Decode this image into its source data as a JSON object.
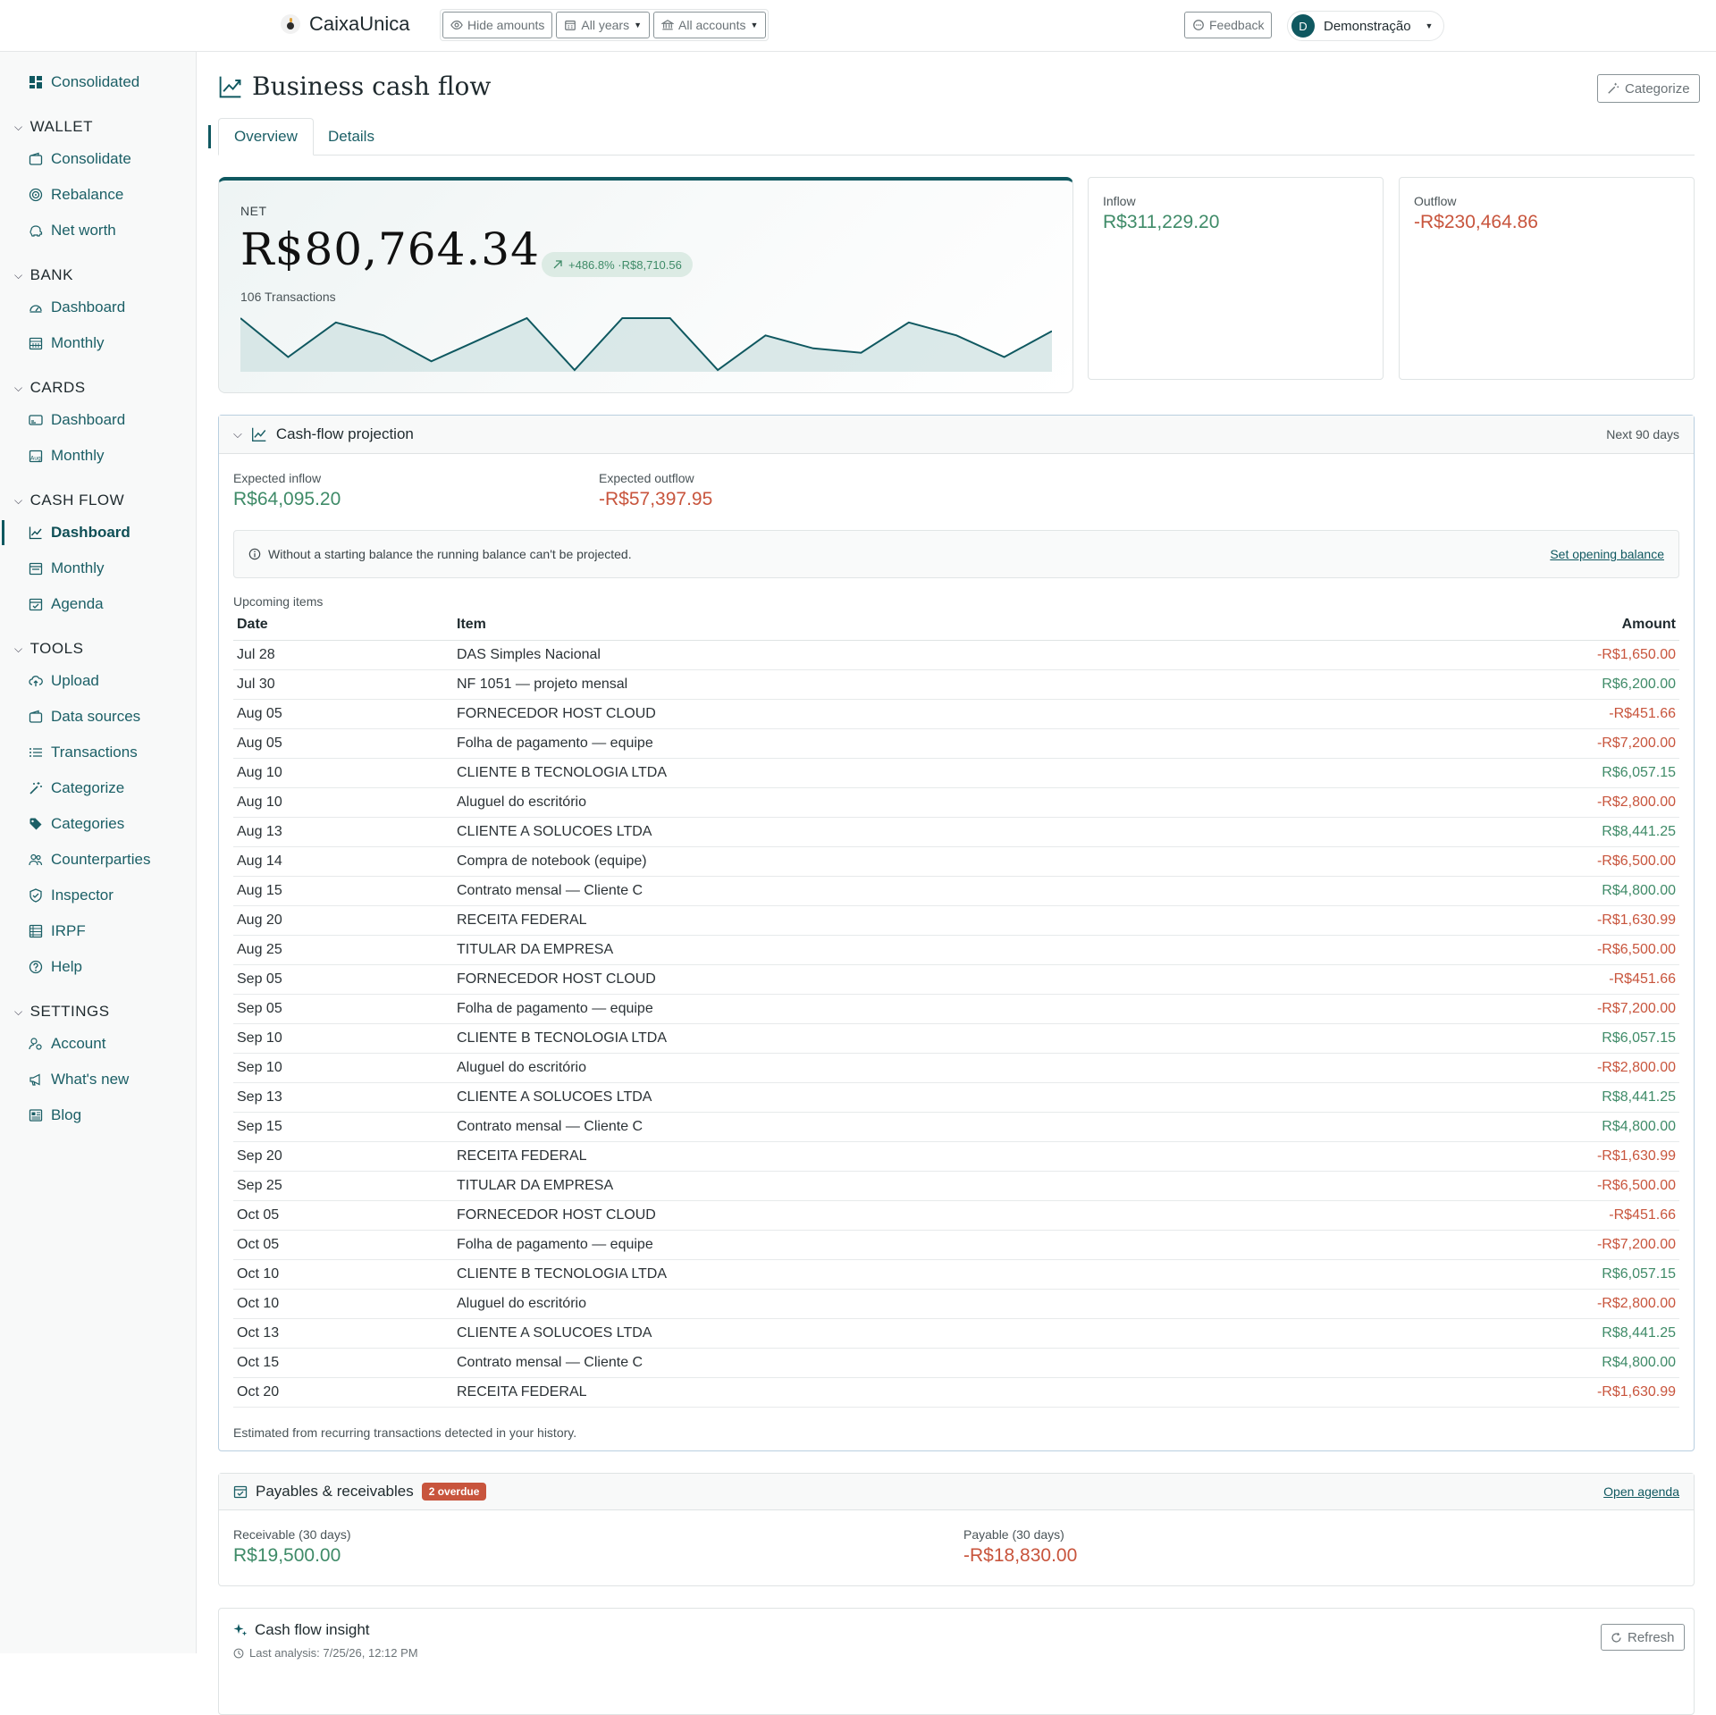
{
  "header": {
    "brand": "CaixaUnica",
    "filters": [
      {
        "label": "Hide amounts",
        "icon": "eye-icon"
      },
      {
        "label": "All years",
        "icon": "calendar-icon"
      },
      {
        "label": "All accounts",
        "icon": "bank-icon"
      }
    ],
    "feedback_label": "Feedback",
    "user": {
      "initial": "D",
      "name": "Demonstração"
    }
  },
  "sidebar": {
    "top_item": "Consolidated",
    "sections": [
      {
        "title": "WALLET",
        "items": [
          "Consolidate",
          "Rebalance",
          "Net worth"
        ]
      },
      {
        "title": "BANK",
        "items": [
          "Dashboard",
          "Monthly"
        ]
      },
      {
        "title": "CARDS",
        "items": [
          "Dashboard",
          "Monthly"
        ]
      },
      {
        "title": "CASH FLOW",
        "items": [
          "Dashboard",
          "Monthly",
          "Agenda"
        ],
        "active": "Dashboard"
      },
      {
        "title": "TOOLS",
        "items": [
          "Upload",
          "Data sources",
          "Transactions",
          "Categorize",
          "Categories",
          "Counterparties",
          "Inspector",
          "IRPF",
          "Help"
        ]
      },
      {
        "title": "SETTINGS",
        "items": [
          "Account",
          "What's new",
          "Blog"
        ]
      }
    ]
  },
  "page": {
    "title": "Business cash flow",
    "categorize_label": "Categorize",
    "tabs": [
      {
        "label": "Overview",
        "active": true
      },
      {
        "label": "Details",
        "active": false
      }
    ]
  },
  "net": {
    "label": "NET",
    "value": "R$80,764.34",
    "badge": "+486.8% ·R$8,710.56",
    "transactions": "106 Transactions",
    "sparkline": [
      12,
      3,
      11,
      8,
      2,
      7,
      12,
      0,
      12,
      12,
      0,
      8,
      5,
      4,
      11,
      8,
      3,
      9
    ]
  },
  "inflow": {
    "label": "Inflow",
    "value": "R$311,229.20"
  },
  "outflow": {
    "label": "Outflow",
    "value": "-R$230,464.86"
  },
  "projection": {
    "title": "Cash-flow projection",
    "range": "Next 90 days",
    "expected_inflow_label": "Expected inflow",
    "expected_inflow": "R$64,095.20",
    "expected_outflow_label": "Expected outflow",
    "expected_outflow": "-R$57,397.95",
    "notice": "Without a starting balance the running balance can't be projected.",
    "notice_link": "Set opening balance",
    "upcoming_label": "Upcoming items",
    "columns": {
      "date": "Date",
      "item": "Item",
      "amount": "Amount"
    },
    "rows": [
      {
        "date": "Jul 28",
        "item": "DAS Simples Nacional",
        "amount": "-R$1,650.00",
        "sign": "neg"
      },
      {
        "date": "Jul 30",
        "item": "NF 1051 — projeto mensal",
        "amount": "R$6,200.00",
        "sign": "pos"
      },
      {
        "date": "Aug 05",
        "item": "FORNECEDOR HOST CLOUD",
        "amount": "-R$451.66",
        "sign": "neg"
      },
      {
        "date": "Aug 05",
        "item": "Folha de pagamento — equipe",
        "amount": "-R$7,200.00",
        "sign": "neg"
      },
      {
        "date": "Aug 10",
        "item": "CLIENTE B TECNOLOGIA LTDA",
        "amount": "R$6,057.15",
        "sign": "pos"
      },
      {
        "date": "Aug 10",
        "item": "Aluguel do escritório",
        "amount": "-R$2,800.00",
        "sign": "neg"
      },
      {
        "date": "Aug 13",
        "item": "CLIENTE A SOLUCOES LTDA",
        "amount": "R$8,441.25",
        "sign": "pos"
      },
      {
        "date": "Aug 14",
        "item": "Compra de notebook (equipe)",
        "amount": "-R$6,500.00",
        "sign": "neg"
      },
      {
        "date": "Aug 15",
        "item": "Contrato mensal — Cliente C",
        "amount": "R$4,800.00",
        "sign": "pos"
      },
      {
        "date": "Aug 20",
        "item": "RECEITA FEDERAL",
        "amount": "-R$1,630.99",
        "sign": "neg"
      },
      {
        "date": "Aug 25",
        "item": "TITULAR DA EMPRESA",
        "amount": "-R$6,500.00",
        "sign": "neg"
      },
      {
        "date": "Sep 05",
        "item": "FORNECEDOR HOST CLOUD",
        "amount": "-R$451.66",
        "sign": "neg"
      },
      {
        "date": "Sep 05",
        "item": "Folha de pagamento — equipe",
        "amount": "-R$7,200.00",
        "sign": "neg"
      },
      {
        "date": "Sep 10",
        "item": "CLIENTE B TECNOLOGIA LTDA",
        "amount": "R$6,057.15",
        "sign": "pos"
      },
      {
        "date": "Sep 10",
        "item": "Aluguel do escritório",
        "amount": "-R$2,800.00",
        "sign": "neg"
      },
      {
        "date": "Sep 13",
        "item": "CLIENTE A SOLUCOES LTDA",
        "amount": "R$8,441.25",
        "sign": "pos"
      },
      {
        "date": "Sep 15",
        "item": "Contrato mensal — Cliente C",
        "amount": "R$4,800.00",
        "sign": "pos"
      },
      {
        "date": "Sep 20",
        "item": "RECEITA FEDERAL",
        "amount": "-R$1,630.99",
        "sign": "neg"
      },
      {
        "date": "Sep 25",
        "item": "TITULAR DA EMPRESA",
        "amount": "-R$6,500.00",
        "sign": "neg"
      },
      {
        "date": "Oct 05",
        "item": "FORNECEDOR HOST CLOUD",
        "amount": "-R$451.66",
        "sign": "neg"
      },
      {
        "date": "Oct 05",
        "item": "Folha de pagamento — equipe",
        "amount": "-R$7,200.00",
        "sign": "neg"
      },
      {
        "date": "Oct 10",
        "item": "CLIENTE B TECNOLOGIA LTDA",
        "amount": "R$6,057.15",
        "sign": "pos"
      },
      {
        "date": "Oct 10",
        "item": "Aluguel do escritório",
        "amount": "-R$2,800.00",
        "sign": "neg"
      },
      {
        "date": "Oct 13",
        "item": "CLIENTE A SOLUCOES LTDA",
        "amount": "R$8,441.25",
        "sign": "pos"
      },
      {
        "date": "Oct 15",
        "item": "Contrato mensal — Cliente C",
        "amount": "R$4,800.00",
        "sign": "pos"
      },
      {
        "date": "Oct 20",
        "item": "RECEITA FEDERAL",
        "amount": "-R$1,630.99",
        "sign": "neg"
      }
    ],
    "footnote": "Estimated from recurring transactions detected in your history."
  },
  "payables": {
    "title": "Payables & receivables",
    "overdue_badge": "2 overdue",
    "link": "Open agenda",
    "receivable_label": "Receivable (30 days)",
    "receivable": "R$19,500.00",
    "payable_label": "Payable (30 days)",
    "payable": "-R$18,830.00"
  },
  "insight": {
    "title": "Cash flow insight",
    "last_analysis": "Last analysis: 7/25/26, 12:12 PM",
    "refresh_label": "Refresh"
  },
  "colors": {
    "accent": "#0f5860",
    "positive": "#3f8b68",
    "negative": "#c8553d"
  }
}
